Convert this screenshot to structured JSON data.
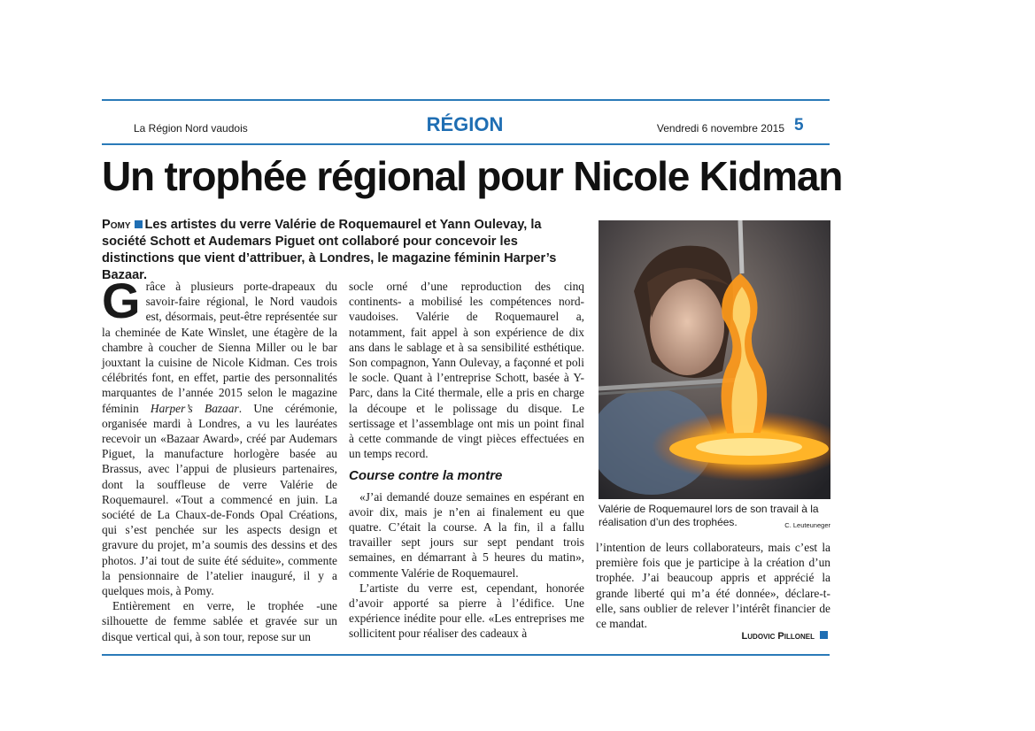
{
  "header": {
    "publication": "La Région Nord vaudois",
    "section": "RÉGION",
    "date": "Vendredi 6 novembre 2015",
    "page": "5"
  },
  "article": {
    "headline": "Un trophée régional pour Nicole Kidman",
    "lead_kicker": "Pomy",
    "lead": "Les artistes du verre Valérie de Roquemaurel et Yann Oulevay, la société Schott et Audemars Piguet ont collaboré pour concevoir les distinctions que vient d’attribuer, à Londres, le magazine féminin Harper’s Bazaar.",
    "dropcap": "G",
    "p1": "râce à plusieurs porte-drapeaux du savoir-faire régional, le Nord vaudois est, désormais, peut-être représentée sur la cheminée de Kate Winslet, une étagère de la chambre à coucher de Sienna Miller ou le bar jouxtant la cuisine de Nicole Kidman. Ces trois célébrités font, en effet, partie des personnalités marquantes de l’année 2015 selon le magazine féminin ",
    "p1_italic": "Harper’s Bazaar",
    "p1_rest": ". Une cérémonie, organisée mardi à Londres, a vu les lauréates recevoir un «Bazaar Award», créé par Audemars Piguet, la manufacture horlogère basée au Brassus, avec l’appui de plusieurs partenaires, dont la souffleuse de verre Valérie de Roquemaurel. «Tout a commencé en juin. La société de La Chaux-de-Fonds Opal Créations, qui s’est penchée sur les aspects design et gravure du projet, m’a soumis des dessins et des photos. J’ai tout de suite été séduite», commente la pensionnaire de l’atelier inauguré, il y a quelques mois, à Pomy.",
    "p2": "Entièrement en verre, le trophée -une silhouette de femme sablée et gravée sur un disque vertical qui, à son tour, repose sur un socle orné d’une reproduction des cinq continents- a mobilisé les compétences nord-vaudoises. Valérie de Roquemaurel a, notamment, fait appel à son expérience de dix ans dans le sablage et à sa sensibilité esthétique. Son compagnon, Yann Oulevay, a façonné et poli le socle. Quant à l’entreprise Schott, basée à Y-Parc, dans la Cité thermale, elle a pris en charge la découpe et le polissage du disque. Le sertissage et l’assemblage ont mis un point final à cette commande de vingt pièces effectuées en un temps record.",
    "subhead": "Course contre la montre",
    "p3": "«J’ai demandé douze semaines en espérant en avoir dix, mais je n’en ai finalement eu que quatre. C’était la course. A la fin, il a fallu travailler sept jours sur sept pendant trois semaines, en démarrant à 5 heures du matin», commente Valérie de Roquemaurel.",
    "p4a": "L’artiste du verre est, cependant, honorée d’avoir apporté sa pierre à l’édifice. Une expérience inédite pour elle. «Les entreprises me sollicitent pour réaliser des cadeaux à",
    "p4b": "l’intention de leurs collaborateurs, mais c’est la première fois que je participe à la création d’un trophée. J’ai beaucoup appris et apprécié la grande liberté qui m’a été donnée», déclare-t-elle, sans oublier de relever l’intérêt financier de ce mandat.",
    "byline": "Ludovic Pillonel"
  },
  "photo": {
    "caption": "Valérie de Roquemaurel lors de son travail à la réalisation d’un des trophées.",
    "credit": "C. Leuteuneger"
  },
  "colors": {
    "accent": "#1f6eb3",
    "rule": "#2a7ab8"
  }
}
